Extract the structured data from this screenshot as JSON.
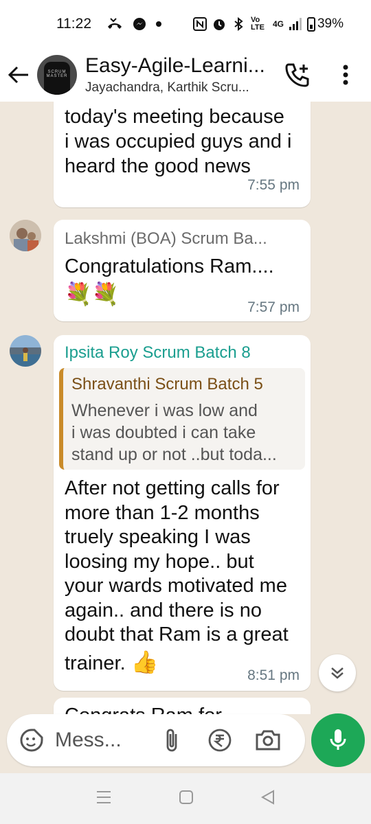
{
  "status_bar": {
    "time": "11:22",
    "network": "4G",
    "volte": "Vo LTE",
    "battery": "39%"
  },
  "header": {
    "title": "Easy-Agile-Learni...",
    "subtitle": "Jayachandra, Karthik Scru...",
    "avatar_text": "SCRUM MASTER"
  },
  "messages": [
    {
      "text_lines": [
        "today's meeting because",
        "i was occupied guys and i",
        "heard the good news"
      ],
      "time": "7:55 pm"
    },
    {
      "sender": "Lakshmi (BOA) Scrum Ba...",
      "sender_color": "#6b6b6b",
      "text": "Congratulations Ram....",
      "emoji": "💐💐",
      "time": "7:57 pm"
    },
    {
      "sender": "Ipsita Roy Scrum Batch 8",
      "sender_color": "#1a9e8f",
      "quote": {
        "name": "Shravanthi Scrum Batch 5",
        "lines": [
          "Whenever i was low and",
          "i was doubted i can take",
          "stand up or not ..but toda..."
        ]
      },
      "text_lines": [
        "After not getting calls for",
        "more than 1-2 months",
        "truely speaking I was",
        "loosing my hope.. but",
        "your wards motivated me",
        "again.. and there is no",
        "doubt that Ram is a great"
      ],
      "last_line": "trainer.",
      "last_emoji": "👍",
      "time": "8:51 pm"
    }
  ],
  "partial_next": "Congrats Ram for",
  "input": {
    "placeholder": "Mess..."
  },
  "colors": {
    "wallpaper": "#efe7dc",
    "accent_green": "#1da857",
    "quote_bar": "#c98b2a"
  }
}
